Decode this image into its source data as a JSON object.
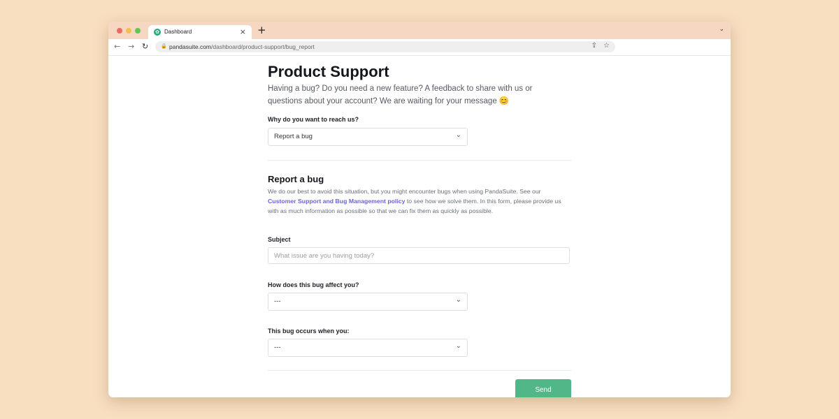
{
  "browser": {
    "tab_title": "Dashboard",
    "tab_close": "×",
    "new_tab": "+",
    "tab_menu": "⌄",
    "url_host": "pandasuite.com",
    "url_path": "/dashboard/product-support/bug_report",
    "icons": [
      "back-icon",
      "forward-icon",
      "reload-icon",
      "lock-icon",
      "share-icon",
      "star-icon"
    ]
  },
  "page": {
    "title": "Product Support",
    "intro": "Having a bug? Do you need a new feature? A feedback to share with us or questions about your account? We are waiting for your message 😊"
  },
  "reason": {
    "label": "Why do you want to reach us?",
    "value": "Report a bug"
  },
  "bug_report": {
    "title": "Report a bug",
    "desc_before": "We do our best to avoid this situation, but you might encounter bugs when using PandaSuite. See our ",
    "policy_link": "Customer Support and Bug Management policy",
    "desc_after": " to see how we solve them. In this form, please provide us with as much information as possible so that we can fix them as quickly as possible.",
    "subject_label": "Subject",
    "subject_placeholder": "What issue are you having today?",
    "subject_value": "",
    "affect_label": "How does this bug affect you?",
    "affect_value": "---",
    "occurs_label": "This bug occurs when you:",
    "occurs_value": "---"
  },
  "actions": {
    "send_label": "Send"
  },
  "colors": {
    "background": "#f8dfc0",
    "tabbar": "#f6d8c2",
    "link": "#6b63d8",
    "send_button": "#52b788"
  }
}
